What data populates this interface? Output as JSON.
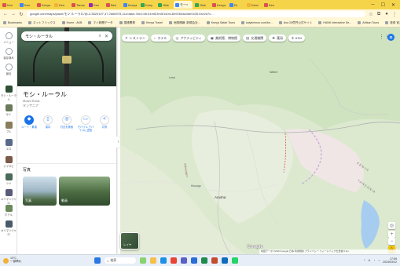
{
  "browser": {
    "tabs": [
      {
        "label": "Ken",
        "color": "#d9534f"
      },
      {
        "label": "Ken",
        "color": "#4285f4"
      },
      {
        "label": "Kenya",
        "color": "#d9534f"
      },
      {
        "label": "Ken",
        "color": "#f2b233"
      },
      {
        "label": "Tanza",
        "color": "#d9534f"
      },
      {
        "label": "Ken",
        "color": "#9c27b0"
      },
      {
        "label": "Bee",
        "color": "#d9534f"
      },
      {
        "label": "Kenya",
        "color": "#4285f4"
      },
      {
        "label": "Keny",
        "color": "#34a853"
      },
      {
        "label": "Glob",
        "color": "#34a853"
      },
      {
        "label": "モー×",
        "color": "#4285f4",
        "active": true
      },
      {
        "label": "Glob",
        "color": "#34a853"
      },
      {
        "label": "Kenya",
        "color": "#d9534f"
      },
      {
        "label": "Kil",
        "color": "#4285f4"
      },
      {
        "label": "Kenv",
        "color": "#f2b233"
      },
      {
        "label": "Ken",
        "color": "#d9534f"
      }
    ],
    "url": "google.com/maps/place/モシ ルーラル/@-3.3820197,37.2666978,11z/data=!3m1!4b1!4m6!3m5!1s0x1839260ab4de0c05:0xe2d7c...",
    "bookmarks": [
      "Bookmarks",
      "ネットフリックス",
      "Home - AKB",
      "マイ新聞データ",
      "国連開発",
      "Kenya Travel",
      "危険情報: 新規会社...",
      "Kenya Safari Tours",
      "kaiyeinmon.com/ke...",
      "Ana 20億円公式サイト",
      "HANK Interactive Se...",
      "Afrikan Tours",
      "旅券 官方機関 - W...",
      "すべてのブックマーク"
    ]
  },
  "rail": [
    {
      "label": "メニュー",
      "color": "#ffffff"
    },
    {
      "label": "保存済み",
      "color": "#ffffff"
    },
    {
      "label": "最近",
      "color": "#ffffff"
    },
    {
      "label": "モシ・ルーラル",
      "color": "#2f4f36"
    },
    {
      "label": "サイ",
      "color": "#6a7a5a"
    },
    {
      "label": "ブル",
      "color": "#8a7e5a"
    },
    {
      "label": "エロ",
      "color": "#5a6a8a"
    },
    {
      "label": "ナイロビ",
      "color": "#7a5a4a"
    },
    {
      "label": "ツメ",
      "color": "#4a6a5a"
    },
    {
      "label": "キリマンジャロ",
      "color": "#5a5a7a"
    },
    {
      "label": "ホテル",
      "color": "#6a8a5a"
    },
    {
      "label": "キリマンジャロ",
      "color": "#4a5a6a"
    }
  ],
  "panel": {
    "search_value": "モシ・ルーラル",
    "title": "モシ・ルーラル",
    "subtitle": "Moshi Rural",
    "category": "タンザニア",
    "actions": [
      {
        "label": "ルート・乗換",
        "icon": "◆",
        "primary": true
      },
      {
        "label": "保存",
        "icon": "▯",
        "primary": false
      },
      {
        "label": "付近を検索",
        "icon": "◎",
        "primary": false
      },
      {
        "label": "モバイル デバイスに送信",
        "icon": "▭",
        "primary": false
      },
      {
        "label": "共有",
        "icon": "<",
        "primary": false
      }
    ],
    "photos_heading": "写真",
    "photos": [
      {
        "caption": "写真"
      },
      {
        "caption": "動画"
      }
    ]
  },
  "map": {
    "chips": [
      {
        "label": "レストラン",
        "icon": "✕"
      },
      {
        "label": "ホテル",
        "icon": "⌂"
      },
      {
        "label": "アクティビティ",
        "icon": "◎"
      },
      {
        "label": "美術館、博物館",
        "icon": "▣"
      },
      {
        "label": "交通機関",
        "icon": "▤"
      },
      {
        "label": "薬局",
        "icon": "✚"
      },
      {
        "label": "ATM",
        "icon": "$"
      }
    ],
    "avatar_letter": "森",
    "layer_label": "レイヤ",
    "google_logo": "Google",
    "footer": "地図データ ©2024 Google  日本  利用規約  プライバシー  フィードバックを送信  5 km",
    "labels": [
      {
        "text": "Lerai",
        "kind": "place"
      },
      {
        "text": "Naibor",
        "kind": "place"
      },
      {
        "text": "Kisongo",
        "kind": "place"
      },
      {
        "text": "Arusha",
        "kind": "place"
      },
      {
        "text": "KENYA",
        "kind": "country"
      },
      {
        "text": "TANZANIA",
        "kind": "country"
      },
      {
        "text": "Kilimanjaro",
        "kind": "region"
      }
    ]
  },
  "taskbar": {
    "weather_temp": "19°C",
    "weather_desc": "一部晴れ",
    "search_placeholder": "検索",
    "ime": "A",
    "time": "17:59",
    "date": "2024/03/12"
  }
}
